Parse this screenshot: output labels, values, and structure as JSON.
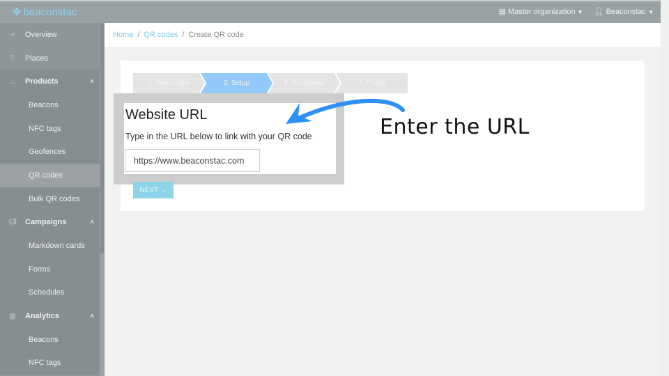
{
  "header": {
    "logo": "beaconstac",
    "org": "Master organization",
    "user": "Beaconstac"
  },
  "sidebar": {
    "items": [
      {
        "label": "Overview",
        "icon": "dashboard-icon"
      },
      {
        "label": "Places",
        "icon": "map-pin-icon"
      },
      {
        "label": "Products",
        "icon": "sitemap-icon"
      },
      {
        "label": "Beacons"
      },
      {
        "label": "NFC tags"
      },
      {
        "label": "Geofences"
      },
      {
        "label": "QR codes"
      },
      {
        "label": "Bulk QR codes"
      },
      {
        "label": "Campaigns",
        "icon": "megaphone-icon"
      },
      {
        "label": "Markdown cards"
      },
      {
        "label": "Forms"
      },
      {
        "label": "Schedules"
      },
      {
        "label": "Analytics",
        "icon": "bar-chart-icon"
      },
      {
        "label": "Beacons"
      },
      {
        "label": "NFC tags"
      }
    ]
  },
  "breadcrumb": {
    "home": "Home",
    "qr": "QR codes",
    "current": "Create QR code",
    "sep": "/"
  },
  "steps": [
    "1. Select type",
    "2. Setup",
    "3. Customize",
    "4. Finish"
  ],
  "form": {
    "title": "Website URL",
    "desc": "Type in the URL below to link with your QR code",
    "url": "https://www.beaconstac.com",
    "next": "NEXT →"
  },
  "annotation": "Enter the URL",
  "colors": {
    "accent": "#8fd3ea",
    "active_step": "#93c8fb",
    "arrow": "#2e90f5"
  }
}
